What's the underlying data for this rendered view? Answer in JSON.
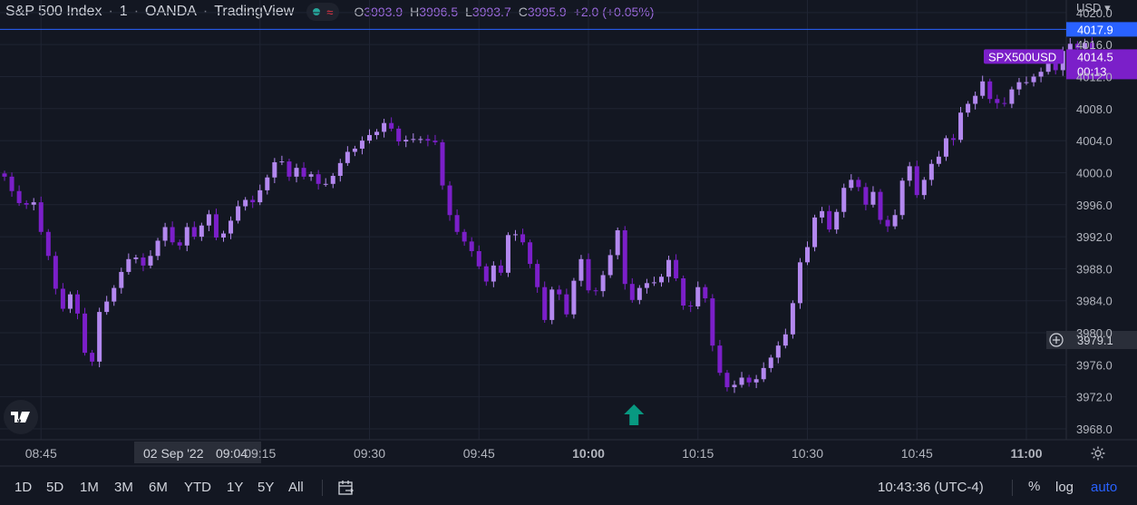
{
  "legend": {
    "symbol": "S&P 500 Index",
    "interval": "1",
    "broker": "OANDA",
    "source": "TradingView",
    "wave_glyph": "≈",
    "o_label": "O",
    "o": "3993.9",
    "h_label": "H",
    "h": "3996.5",
    "l_label": "L",
    "l": "3993.7",
    "c_label": "C",
    "c": "3995.9",
    "change": "+2.0 (+0.05%)"
  },
  "currency": "USD",
  "price_axis": {
    "ticks": [
      "4020.0",
      "4016.0",
      "4012.0",
      "4008.0",
      "4004.0",
      "4000.0",
      "3996.0",
      "3992.0",
      "3988.0",
      "3984.0",
      "3980.0",
      "3976.0",
      "3972.0",
      "3968.0"
    ]
  },
  "time_axis": {
    "ticks": [
      {
        "t": "08:45",
        "label": "08:45",
        "bold": false
      },
      {
        "t": "09:15",
        "label": "09:15",
        "bold": false
      },
      {
        "t": "09:30",
        "label": "09:30",
        "bold": false
      },
      {
        "t": "09:45",
        "label": "09:45",
        "bold": false
      },
      {
        "t": "10:00",
        "label": "10:00",
        "bold": true
      },
      {
        "t": "10:15",
        "label": "10:15",
        "bold": false
      },
      {
        "t": "10:30",
        "label": "10:30",
        "bold": false
      },
      {
        "t": "10:45",
        "label": "10:45",
        "bold": false
      },
      {
        "t": "11:00",
        "label": "11:00",
        "bold": true
      }
    ],
    "crosshair_date": "02 Sep '22",
    "crosshair_time": "09:04"
  },
  "markers": {
    "high_line": {
      "price": 4017.9,
      "label": "4017.9"
    },
    "last_price": {
      "name": "SPX500USD",
      "price": 4014.5,
      "label": "4014.5",
      "countdown": "00:13"
    },
    "crosshair_price": {
      "price": 3979.1,
      "label": "3979.1"
    },
    "arrow_time": "10:05"
  },
  "timeframes": [
    "1D",
    "5D",
    "1M",
    "3M",
    "6M",
    "YTD",
    "1Y",
    "5Y",
    "All"
  ],
  "clock": "10:43:36 (UTC-4)",
  "scale_buttons": {
    "percent": "%",
    "log": "log",
    "auto": "auto"
  },
  "colors": {
    "background": "#131722",
    "up": "#b388ef",
    "down": "#7b1fc9",
    "accent_line": "#2962ff",
    "arrow": "#089981",
    "last_label": "#7b1fc9"
  },
  "chart_data": {
    "type": "candlestick",
    "timeframe": "1 minute",
    "time_start": "08:40",
    "time_end": "10:44",
    "ylim": [
      3968,
      4020
    ],
    "grid": true,
    "closes": [
      3999.5,
      3997.7,
      3996.2,
      3996.0,
      3996.3,
      3992.6,
      3989.6,
      3985.5,
      3983.0,
      3984.8,
      3982.4,
      3977.5,
      3976.4,
      3982.6,
      3983.9,
      3985.6,
      3987.6,
      3989.2,
      3989.4,
      3988.4,
      3989.6,
      3991.5,
      3993.2,
      3991.3,
      3990.9,
      3993.2,
      3992.0,
      3993.4,
      3994.8,
      3991.9,
      3992.4,
      3994.0,
      3995.8,
      3996.6,
      3996.3,
      3997.8,
      3999.4,
      4001.3,
      4001.4,
      3999.5,
      4000.6,
      3999.5,
      3999.8,
      3998.6,
      3998.6,
      3999.6,
      4001.2,
      4002.6,
      4003.0,
      4004.0,
      4004.7,
      4005.1,
      4006.2,
      4005.5,
      4003.9,
      4004.1,
      4004.2,
      4004.2,
      4004.0,
      4003.8,
      3998.4,
      3994.7,
      3992.6,
      3991.4,
      3990.2,
      3988.3,
      3986.4,
      3988.4,
      3987.5,
      3992.2,
      3992.3,
      3991.3,
      3988.6,
      3985.7,
      3981.6,
      3985.4,
      3984.8,
      3982.3,
      3986.5,
      3989.2,
      3985.3,
      3985.2,
      3987.2,
      3989.7,
      3992.8,
      3986.1,
      3984.1,
      3985.6,
      3986.2,
      3986.3,
      3987.0,
      3989.1,
      3986.8,
      3983.4,
      3983.3,
      3985.7,
      3984.3,
      3978.4,
      3975.0,
      3973.2,
      3973.5,
      3974.4,
      3973.8,
      3974.2,
      3975.6,
      3976.9,
      3978.4,
      3979.8,
      3983.7,
      3988.8,
      3990.7,
      3994.4,
      3995.2,
      3992.9,
      3995.1,
      3998.1,
      3999.1,
      3998.2,
      3996.0,
      3997.6,
      3994.1,
      3993.3,
      3994.7,
      3999.0,
      4000.8,
      3997.2,
      3999.1,
      4001.1,
      4002.0,
      4004.3,
      4004.1,
      4007.5,
      4008.6,
      4009.6,
      4011.4,
      4009.2,
      4008.7,
      4008.6,
      4010.4,
      4011.3,
      4011.3,
      4012.0,
      4012.6,
      4014.0,
      4012.8,
      4015.2,
      4016.1,
      4015.5,
      4016.2,
      4014.5
    ]
  }
}
